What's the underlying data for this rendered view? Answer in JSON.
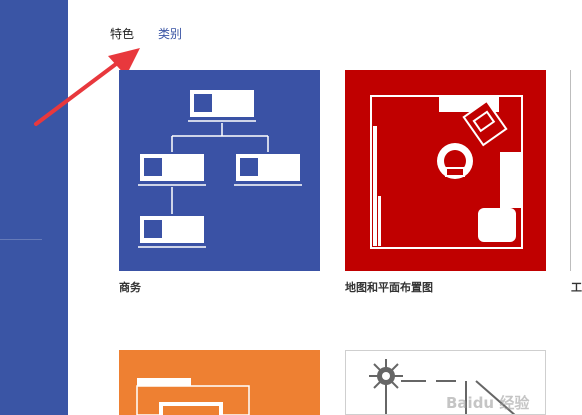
{
  "tabs": [
    {
      "label": "特色"
    },
    {
      "label": "类别"
    }
  ],
  "templates": [
    {
      "label": "商务",
      "color": "#3a52a5"
    },
    {
      "label": "地图和平面布置图",
      "color": "#c00000"
    },
    {
      "label": "工"
    },
    {
      "label": "",
      "color": "#ee8032"
    },
    {
      "label": ""
    }
  ],
  "colors": {
    "sidebar": "#3a55a5",
    "active_tab": "#3a55a5",
    "annotation_arrow": "#e8383d"
  },
  "watermark": "Baidu 经验"
}
